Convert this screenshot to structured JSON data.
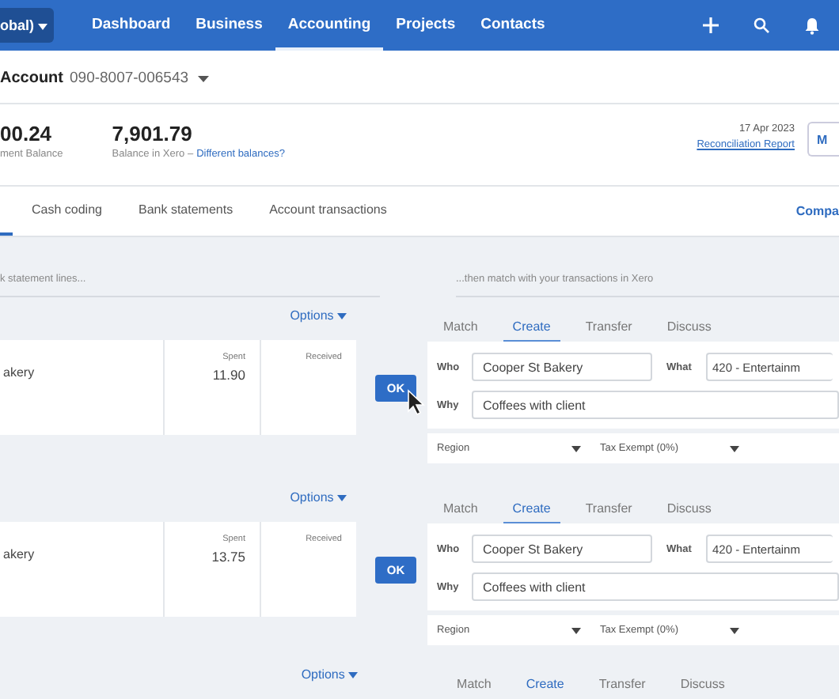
{
  "nav": {
    "org": "obal)",
    "items": [
      {
        "label": "Dashboard",
        "selected": false
      },
      {
        "label": "Business",
        "selected": false
      },
      {
        "label": "Accounting",
        "selected": true
      },
      {
        "label": "Projects",
        "selected": false
      },
      {
        "label": "Contacts",
        "selected": false
      }
    ]
  },
  "account": {
    "label": "Account",
    "number": "090-8007-006543"
  },
  "balances": [
    {
      "amount": "00.24",
      "label": "ment Balance"
    },
    {
      "amount": "7,901.79",
      "label": "Balance in Xero –",
      "link": "Different balances?"
    }
  ],
  "reconcile": {
    "date": "17 Apr 2023",
    "link": "Reconciliation Report",
    "button": "M"
  },
  "tabs": [
    {
      "selected": true
    },
    {
      "label": "Cash coding",
      "selected": false
    },
    {
      "label": "Bank statements",
      "selected": false
    },
    {
      "label": "Account transactions",
      "selected": false
    }
  ],
  "compare_link": "Compa",
  "left_heading": "k statement lines...",
  "right_heading": "...then match with your transactions in Xero",
  "lines": [
    {
      "kind": "full",
      "options": "Options",
      "payee": "akery",
      "spent_label": "Spent",
      "spent": "11.90",
      "received_label": "Received",
      "ok": "OK",
      "cursor": true,
      "match_tabs": [
        {
          "label": "Match",
          "selected": false
        },
        {
          "label": "Create",
          "selected": true
        },
        {
          "label": "Transfer",
          "selected": false
        },
        {
          "label": "Discuss",
          "selected": false
        }
      ],
      "who_label": "Who",
      "who": "Cooper St Bakery",
      "what_label": "What",
      "what": "420 - Entertainm",
      "why_label": "Why",
      "why": "Coffees with client",
      "region": "Region",
      "tax": "Tax Exempt (0%)"
    },
    {
      "kind": "full",
      "options": "Options",
      "payee": "akery",
      "spent_label": "Spent",
      "spent": "13.75",
      "received_label": "Received",
      "ok": "OK",
      "cursor": false,
      "match_tabs": [
        {
          "label": "Match",
          "selected": false
        },
        {
          "label": "Create",
          "selected": true
        },
        {
          "label": "Transfer",
          "selected": false
        },
        {
          "label": "Discuss",
          "selected": false
        }
      ],
      "who_label": "Who",
      "who": "Cooper St Bakery",
      "what_label": "What",
      "what": "420 - Entertainm",
      "why_label": "Why",
      "why": "Coffees with client",
      "region": "Region",
      "tax": "Tax Exempt (0%)"
    },
    {
      "kind": "partial",
      "options": "Options",
      "match_tabs": [
        {
          "label": "Match",
          "selected": false
        },
        {
          "label": "Create",
          "selected": true
        },
        {
          "label": "Transfer",
          "selected": false
        },
        {
          "label": "Discuss",
          "selected": false
        }
      ]
    }
  ]
}
